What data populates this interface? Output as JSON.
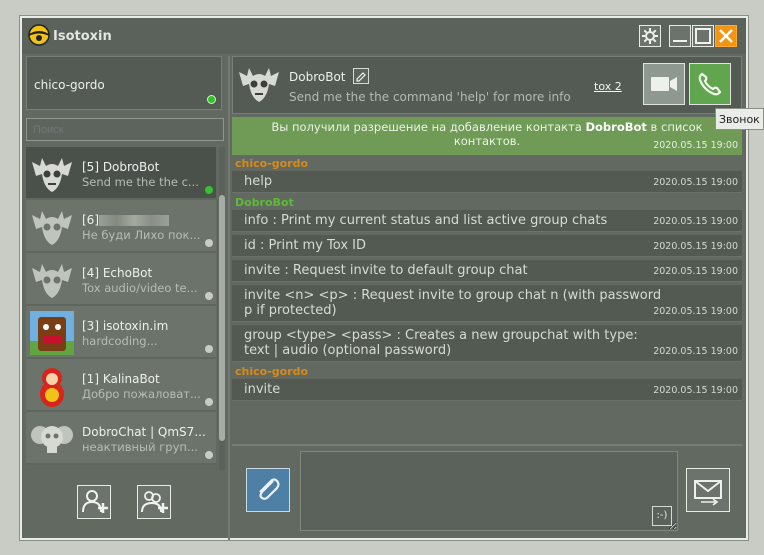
{
  "app": {
    "title": "Isotoxin",
    "accent": "#6f9b57",
    "close_color": "#f39412"
  },
  "window_controls": {
    "settings_icon": "gear-icon",
    "minimize_icon": "minimize-icon",
    "maximize_icon": "maximize-icon",
    "close_icon": "close-icon"
  },
  "profile": {
    "name": "chico-gordo",
    "status": "online"
  },
  "search": {
    "placeholder": "Поиск"
  },
  "contacts": [
    {
      "name": "[5] DobroBot",
      "status": "Send me the the c...",
      "avatar": "bat-skull-avatar",
      "active": true
    },
    {
      "name": "[6]",
      "status": "Не буди Лихо пок...",
      "avatar": "bat-skull-avatar"
    },
    {
      "name": "[4] EchoBot",
      "status": "Tox audio/video te...",
      "avatar": "bat-skull-avatar"
    },
    {
      "name": "[3] isotoxin.im",
      "status": "hardcoding...",
      "avatar": "domo-kun-avatar"
    },
    {
      "name": "[1] KalinaBot",
      "status": "Добро пожаловат...",
      "avatar": "matryoshka-avatar"
    },
    {
      "name": "DobroChat | QmS7...",
      "status": "неактивный груп...",
      "avatar": "group-skulls-avatar"
    }
  ],
  "left_actions": {
    "add_contact_icon": "add-contact-icon",
    "add_group_icon": "add-group-icon"
  },
  "chat": {
    "name": "DobroBot",
    "status": "Send me the the command 'help' for more info",
    "protocol_link": "tox 2",
    "video_icon": "video-camera-icon",
    "call_icon": "phone-icon",
    "tooltip": "Звонок"
  },
  "notice": {
    "text_before": "Вы получили разрешение на добавление контакта ",
    "contact": "DobroBot",
    "text_after": " в список контактов.",
    "time": "2020.05.15 19:00"
  },
  "messages": [
    {
      "sender": "chico-gordo",
      "sender_color": "#d68a1c",
      "text": "help",
      "time": "2020.05.15 19:00"
    },
    {
      "sender": "DobroBot",
      "sender_color": "#5dbb35",
      "text": "info : Print my current status and list active group chats",
      "time": "2020.05.15 19:00"
    },
    {
      "text": "id : Print my Tox ID",
      "time": "2020.05.15 19:00"
    },
    {
      "text": "invite : Request invite to default group chat",
      "time": "2020.05.15 19:00"
    },
    {
      "text": "invite <n> <p> : Request invite to group chat n (with password p if protected)",
      "time": "2020.05.15 19:00"
    },
    {
      "text": "group <type> <pass> : Creates a new groupchat with type: text | audio (optional password)",
      "time": "2020.05.15 19:00"
    },
    {
      "sender": "chico-gordo",
      "sender_color": "#d68a1c",
      "text": "invite",
      "time": "2020.05.15 19:00"
    }
  ],
  "compose": {
    "attach_icon": "paperclip-icon",
    "smiley": ":-)",
    "send_icon": "envelope-send-icon"
  }
}
